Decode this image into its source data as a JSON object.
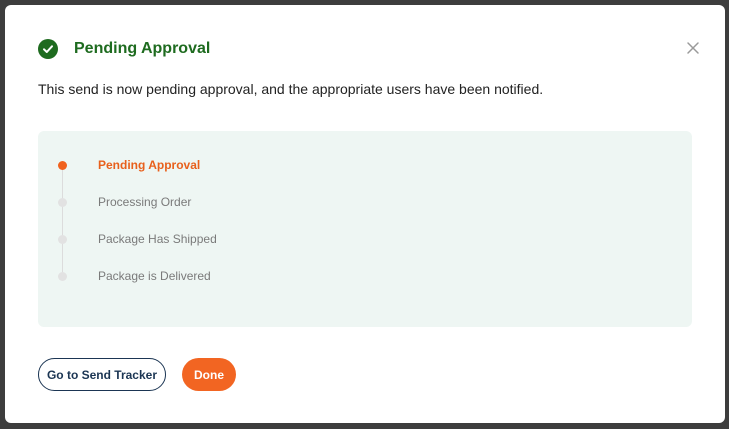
{
  "modal": {
    "title": "Pending Approval",
    "message": "This send is now pending approval, and the appropriate users have been notified.",
    "header_icon": "check-circle-icon",
    "close_icon": "close-icon",
    "accent_color": "#f26522",
    "success_color": "#1e6b1f"
  },
  "steps": [
    {
      "label": "Pending Approval",
      "status": "active"
    },
    {
      "label": "Processing Order",
      "status": "pending"
    },
    {
      "label": "Package Has Shipped",
      "status": "pending"
    },
    {
      "label": "Package is Delivered",
      "status": "pending"
    }
  ],
  "buttons": {
    "tracker_label": "Go to Send Tracker",
    "done_label": "Done"
  }
}
